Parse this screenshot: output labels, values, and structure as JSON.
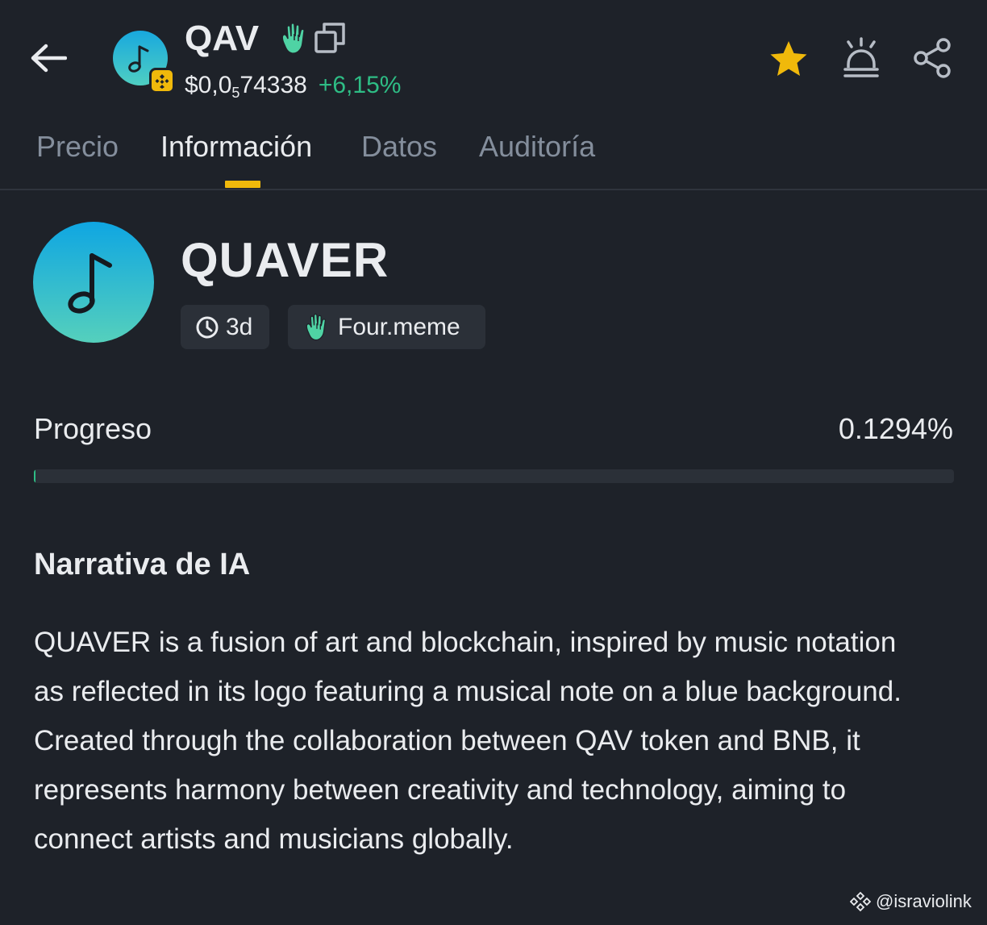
{
  "header": {
    "ticker": "QAV",
    "price_main": "$0,0",
    "price_zeros": "5",
    "price_tail": "74338",
    "change": "+6,15%",
    "back_icon": "arrow-left-icon",
    "copy_icon": "copy-icon",
    "star_icon": "star-icon",
    "alert_icon": "alarm-icon",
    "share_icon": "share-icon"
  },
  "tabs": [
    {
      "label": "Precio",
      "active": false
    },
    {
      "label": "Información",
      "active": true
    },
    {
      "label": "Datos",
      "active": false
    },
    {
      "label": "Auditoría",
      "active": false
    }
  ],
  "token": {
    "name": "QUAVER",
    "age": "3d",
    "platform": "Four.meme"
  },
  "progress": {
    "label": "Progreso",
    "value_text": "0.1294%",
    "percent": 0.1294
  },
  "narrative": {
    "title": "Narrativa de IA",
    "body": "QUAVER is a fusion of art and blockchain, inspired by music notation as reflected in its logo featuring a musical note on a blue background. Created through the collaboration between QAV token and BNB, it represents harmony between creativity and technology, aiming to connect artists and musicians globally."
  },
  "watermark": {
    "text": "@israviolink"
  },
  "colors": {
    "background": "#1e2229",
    "accent": "#f0b90b",
    "positive": "#2ebd85",
    "muted": "#848e9c"
  }
}
